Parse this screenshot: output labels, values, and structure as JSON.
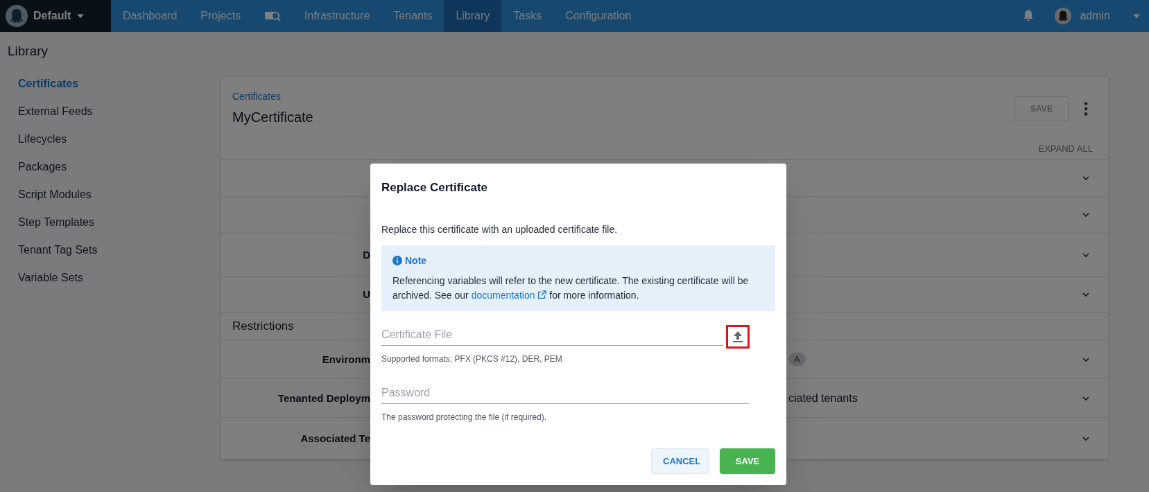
{
  "top_nav": {
    "space": "Default",
    "items": [
      {
        "kind": "text",
        "label": "Dashboard",
        "selected": false
      },
      {
        "kind": "text",
        "label": "Projects",
        "selected": false
      },
      {
        "kind": "icon",
        "selected": false
      },
      {
        "kind": "text",
        "label": "Infrastructure",
        "selected": false
      },
      {
        "kind": "text",
        "label": "Tenants",
        "selected": false
      },
      {
        "kind": "text",
        "label": "Library",
        "selected": true
      },
      {
        "kind": "text",
        "label": "Tasks",
        "selected": false
      },
      {
        "kind": "text",
        "label": "Configuration",
        "selected": false
      }
    ],
    "user": "admin"
  },
  "page_title": "Library",
  "sidebar": {
    "items": [
      {
        "label": "Certificates",
        "selected": true
      },
      {
        "label": "External Feeds",
        "selected": false
      },
      {
        "label": "Lifecycles",
        "selected": false
      },
      {
        "label": "Packages",
        "selected": false
      },
      {
        "label": "Script Modules",
        "selected": false
      },
      {
        "label": "Step Templates",
        "selected": false
      },
      {
        "label": "Tenant Tag Sets",
        "selected": false
      },
      {
        "label": "Variable Sets",
        "selected": false
      }
    ]
  },
  "card": {
    "breadcrumb": "Certificates",
    "title": "MyCertificate",
    "save_button": "SAVE",
    "expand_all": "EXPAND ALL",
    "rows": [
      {
        "kind": "row"
      },
      {
        "kind": "row"
      },
      {
        "kind": "row",
        "label": "D"
      },
      {
        "kind": "row",
        "label": "U"
      },
      {
        "kind": "heading",
        "label": "Restrictions"
      },
      {
        "kind": "row",
        "label": "Environm",
        "chip": "A"
      },
      {
        "kind": "row",
        "label": "Tenanted Deploym",
        "value": "ciated tenants"
      },
      {
        "kind": "row",
        "label": "Associated Te"
      }
    ]
  },
  "dialog": {
    "title": "Replace Certificate",
    "description": "Replace this certificate with an uploaded certificate file.",
    "note": {
      "title": "Note",
      "text_before": "Referencing variables will refer to the new certificate. The existing certificate will be archived. See our",
      "link": "documentation",
      "text_after": "for more information."
    },
    "fields": [
      {
        "kind": "file",
        "placeholder": "Certificate File",
        "help": "Supported formats: PFX (PKCS #12), DER, PEM",
        "highlighted": true
      },
      {
        "kind": "password",
        "placeholder": "Password",
        "help": "The password protecting the file (if required)."
      }
    ],
    "buttons": [
      {
        "kind": "secondary",
        "label": "CANCEL"
      },
      {
        "kind": "primary",
        "label": "SAVE"
      }
    ]
  }
}
